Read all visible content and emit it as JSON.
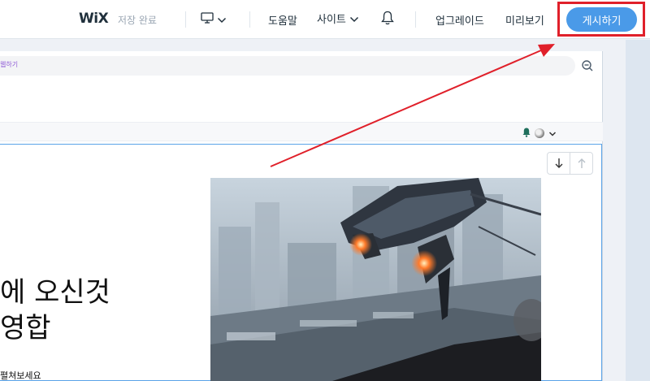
{
  "topbar": {
    "logo": "WiX",
    "save_status": "저장 완료",
    "help": "도움말",
    "site": "사이트",
    "upgrade": "업그레이드",
    "preview": "미리보기",
    "publish": "게시하기"
  },
  "canvas": {
    "url_text": "웹하기"
  },
  "hero": {
    "title_line1": "에 오신것",
    "title_line2": "영합",
    "subtitle": "펼쳐보세요"
  },
  "colors": {
    "publish": "#4a9ae8",
    "highlight": "#e0202a",
    "selection": "#5aa3e8"
  }
}
